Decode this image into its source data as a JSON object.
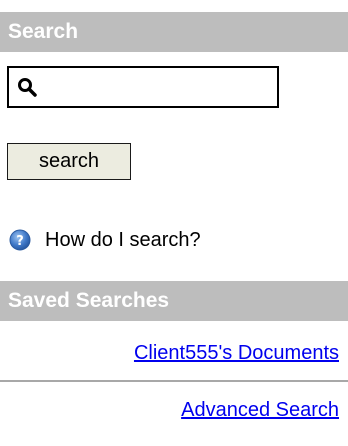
{
  "search_section": {
    "header": "Search",
    "input_value": "",
    "button_label": "search",
    "help_text": "How do I search?"
  },
  "saved_section": {
    "header": "Saved Searches",
    "items": [
      "Client555's Documents"
    ]
  },
  "advanced_link": "Advanced Search",
  "colors": {
    "header_bg": "#bdbdbd",
    "link": "#0000ee",
    "button_bg": "#ecece0",
    "help_icon": "#3f78c8"
  }
}
